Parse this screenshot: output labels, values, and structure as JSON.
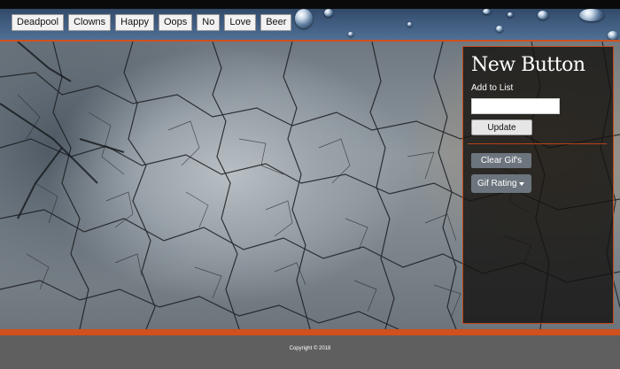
{
  "header": {
    "topic_buttons": [
      "Deadpool",
      "Clowns",
      "Happy",
      "Oops",
      "No",
      "Love",
      "Beer"
    ]
  },
  "panel": {
    "title": "New Button",
    "add_label": "Add to List",
    "input_value": "",
    "update_label": "Update",
    "clear_label": "Clear Gif's",
    "rating_label": "Gif Rating"
  },
  "footer": {
    "copyright": "Copyright © 2018"
  },
  "colors": {
    "accent": "#d0511e",
    "header_blue": "#3b5678",
    "panel_bg": "#141210",
    "secondary_button": "#6c757d",
    "footer_bg": "#5f5f5f"
  },
  "icons": {
    "rating_caret": "caret-down-icon"
  }
}
